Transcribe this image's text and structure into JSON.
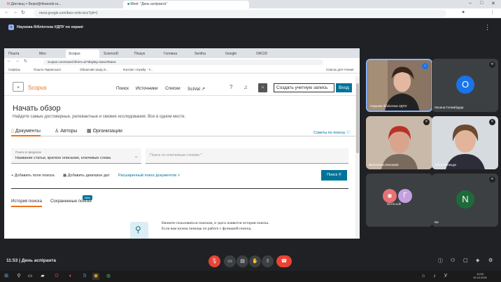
{
  "outer_browser": {
    "tabs": [
      "Дистанц > Бюро@rtkaexeb.ru...",
      "Meet: \"День аспіранта\""
    ],
    "address": "meet.google.com/bwx-vmlo-bcz?pli=1"
  },
  "meet": {
    "banner_text": "Наукова бібліотека УДПУ по екрані",
    "meeting_time": "11:53",
    "meeting_name": "День аспіранта"
  },
  "shared_browser": {
    "tabs": [
      "Пошта",
      "Мен",
      "Scopus",
      "ScienceD",
      "Пошук",
      "Головна",
      "Sentha",
      "Google",
      "ORCID"
    ],
    "address": "scopus.com/search/form.uri?display=basic#basic",
    "bookmarks": [
      "Сервісы",
      "Пошта Української",
      "Обласний захід О...",
      "Контакт службу - Y...",
      "Список для чтения"
    ]
  },
  "scopus": {
    "brand": "Scopus",
    "nav": [
      "Поиск",
      "Источники",
      "Списки",
      "SciVal ↗"
    ],
    "create_account": "Создать учетную запись",
    "login": "Вход",
    "page_title": "Начать обзор",
    "subtitle": "Найдите самые достоверные, релевантные и свежие исследования. Все в одном месте.",
    "mode_tabs": [
      "Документы",
      "Авторы",
      "Организации"
    ],
    "search_tips": "Советы по поиску ⓘ",
    "field_label": "Поиск в пределах",
    "field_value": "Название статьи, краткое описание, ключевые слова",
    "keyword_placeholder": "Поиск по ключевым словам *",
    "add_field": "+ Добавить поле поиска",
    "add_range": "Добавить диапазон дат",
    "advanced": "Расширенный поиск документов >",
    "search_button": "Поиск",
    "history_tabs": [
      "История поиска",
      "Сохраненные поиски"
    ],
    "new_badge": "New",
    "empty_text": "Начните пользоваться поиском, и здесь появится история поиска. Если вам нужна помощь по работе с функцией поиска,"
  },
  "participants": [
    {
      "name": "Наукова бібліотека УДПУ",
      "initial": ""
    },
    {
      "name": "Оксана Голембурда",
      "initial": "О"
    },
    {
      "name": "Валентина Бевзюків",
      "initial": ""
    },
    {
      "name": "Світа Полещук",
      "initial": ""
    },
    {
      "name": "Ніл Б ксЙ",
      "initial": "Г"
    },
    {
      "name": "Ne",
      "initial": "N"
    }
  ],
  "taskbar": {
    "time": "11:53",
    "date": "10.12.2021"
  },
  "colors": {
    "scopus_orange": "#e9711c",
    "scopus_blue": "#007398",
    "meet_red": "#ea4335"
  }
}
